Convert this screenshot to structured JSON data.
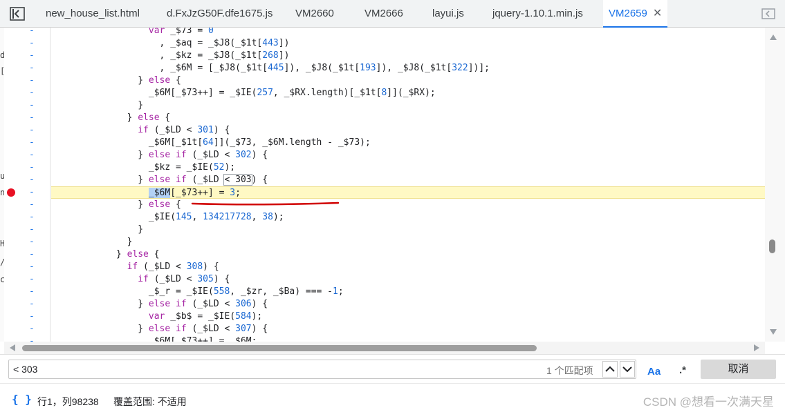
{
  "tabs": [
    {
      "label": "new_house_list.html"
    },
    {
      "label": "d.FxJzG50F.dfe1675.js"
    },
    {
      "label": "VM2660"
    },
    {
      "label": "VM2666"
    },
    {
      "label": "layui.js"
    },
    {
      "label": "jquery-1.10.1.min.js"
    },
    {
      "label": "VM2659",
      "active": true
    }
  ],
  "left_strip_chars": [
    "d",
    "[",
    "u",
    "n",
    "H",
    "/",
    "c"
  ],
  "gutter_marker": "-",
  "code_lines": [
    {
      "indent": "                  ",
      "parts": [
        [
          "kw",
          "var"
        ],
        [
          "p",
          " _$73 = "
        ],
        [
          "num",
          "0"
        ]
      ]
    },
    {
      "indent": "                    ",
      "parts": [
        [
          "p",
          ", _$aq = _$J8(_$1t["
        ],
        [
          "num",
          "443"
        ],
        [
          "p",
          "])"
        ]
      ]
    },
    {
      "indent": "                    ",
      "parts": [
        [
          "p",
          ", _$kz = _$J8(_$1t["
        ],
        [
          "num",
          "268"
        ],
        [
          "p",
          "])"
        ]
      ]
    },
    {
      "indent": "                    ",
      "parts": [
        [
          "p",
          ", _$6M = [_$J8(_$1t["
        ],
        [
          "num",
          "445"
        ],
        [
          "p",
          "]), _$J8(_$1t["
        ],
        [
          "num",
          "193"
        ],
        [
          "p",
          "]), _$J8(_$1t["
        ],
        [
          "num",
          "322"
        ],
        [
          "p",
          "])];"
        ]
      ]
    },
    {
      "indent": "                ",
      "parts": [
        [
          "p",
          "} "
        ],
        [
          "kw",
          "else"
        ],
        [
          "p",
          " {"
        ]
      ]
    },
    {
      "indent": "                  ",
      "parts": [
        [
          "p",
          "_$6M[_$73++] = _$IE("
        ],
        [
          "num",
          "257"
        ],
        [
          "p",
          ", _$RX.length)[_$1t["
        ],
        [
          "num",
          "8"
        ],
        [
          "p",
          "]](_$RX);"
        ]
      ]
    },
    {
      "indent": "                ",
      "parts": [
        [
          "p",
          "}"
        ]
      ]
    },
    {
      "indent": "              ",
      "parts": [
        [
          "p",
          "} "
        ],
        [
          "kw",
          "else"
        ],
        [
          "p",
          " {"
        ]
      ]
    },
    {
      "indent": "                ",
      "parts": [
        [
          "kw",
          "if"
        ],
        [
          "p",
          " (_$LD < "
        ],
        [
          "num",
          "301"
        ],
        [
          "p",
          ") {"
        ]
      ]
    },
    {
      "indent": "                  ",
      "parts": [
        [
          "p",
          "_$6M[_$1t["
        ],
        [
          "num",
          "64"
        ],
        [
          "p",
          "]](_$73, _$6M.length - _$73);"
        ]
      ]
    },
    {
      "indent": "                ",
      "parts": [
        [
          "p",
          "} "
        ],
        [
          "kw",
          "else if"
        ],
        [
          "p",
          " (_$LD < "
        ],
        [
          "num",
          "302"
        ],
        [
          "p",
          ") {"
        ]
      ]
    },
    {
      "indent": "                  ",
      "parts": [
        [
          "p",
          "_$kz = _$IE("
        ],
        [
          "num",
          "52"
        ],
        [
          "p",
          ");"
        ]
      ]
    },
    {
      "indent": "                ",
      "parts": [
        [
          "p",
          "} "
        ],
        [
          "kw",
          "else if"
        ],
        [
          "p",
          " (_$LD "
        ],
        [
          "box",
          "< 303"
        ],
        [
          "p",
          ") {"
        ]
      ]
    },
    {
      "indent": "                  ",
      "parts": [
        [
          "sel",
          "_$6M"
        ],
        [
          "p",
          "[_$73++] = "
        ],
        [
          "num",
          "3"
        ],
        [
          "p",
          ";"
        ]
      ],
      "highlight": true
    },
    {
      "indent": "                ",
      "parts": [
        [
          "p",
          "} "
        ],
        [
          "kw",
          "else"
        ],
        [
          "p",
          " {"
        ]
      ]
    },
    {
      "indent": "                  ",
      "parts": [
        [
          "p",
          "_$IE("
        ],
        [
          "num",
          "145"
        ],
        [
          "p",
          ", "
        ],
        [
          "num",
          "134217728"
        ],
        [
          "p",
          ", "
        ],
        [
          "num",
          "38"
        ],
        [
          "p",
          ");"
        ]
      ]
    },
    {
      "indent": "                ",
      "parts": [
        [
          "p",
          "}"
        ]
      ]
    },
    {
      "indent": "              ",
      "parts": [
        [
          "p",
          "}"
        ]
      ]
    },
    {
      "indent": "            ",
      "parts": [
        [
          "p",
          "} "
        ],
        [
          "kw",
          "else"
        ],
        [
          "p",
          " {"
        ]
      ]
    },
    {
      "indent": "              ",
      "parts": [
        [
          "kw",
          "if"
        ],
        [
          "p",
          " (_$LD < "
        ],
        [
          "num",
          "308"
        ],
        [
          "p",
          ") {"
        ]
      ]
    },
    {
      "indent": "                ",
      "parts": [
        [
          "kw",
          "if"
        ],
        [
          "p",
          " (_$LD < "
        ],
        [
          "num",
          "305"
        ],
        [
          "p",
          ") {"
        ]
      ]
    },
    {
      "indent": "                  ",
      "parts": [
        [
          "p",
          "_$_r = _$IE("
        ],
        [
          "num",
          "558"
        ],
        [
          "p",
          ", _$zr, _$Ba) === -"
        ],
        [
          "num",
          "1"
        ],
        [
          "p",
          ";"
        ]
      ]
    },
    {
      "indent": "                ",
      "parts": [
        [
          "p",
          "} "
        ],
        [
          "kw",
          "else if"
        ],
        [
          "p",
          " (_$LD < "
        ],
        [
          "num",
          "306"
        ],
        [
          "p",
          ") {"
        ]
      ]
    },
    {
      "indent": "                  ",
      "parts": [
        [
          "kw",
          "var"
        ],
        [
          "p",
          " _$b$ = _$IE("
        ],
        [
          "num",
          "584"
        ],
        [
          "p",
          ");"
        ]
      ]
    },
    {
      "indent": "                ",
      "parts": [
        [
          "p",
          "} "
        ],
        [
          "kw",
          "else if"
        ],
        [
          "p",
          " (_$LD < "
        ],
        [
          "num",
          "307"
        ],
        [
          "p",
          ") {"
        ]
      ]
    },
    {
      "indent": "                  ",
      "parts": [
        [
          "p",
          "_$6M[_$73++] = _$6M;"
        ]
      ]
    }
  ],
  "search": {
    "query": "< 303",
    "match_count": "1 个匹配项",
    "case_label": "Aa",
    "regex_label": ".*",
    "cancel_label": "取消"
  },
  "status": {
    "braces": "{ }",
    "position": "行1，列98238",
    "coverage": "覆盖范围: 不适用"
  },
  "watermark": "CSDN @想看一次满天星",
  "colors": {
    "accent": "#1a73e8",
    "breakpoint": "#e81123",
    "highlight_line": "#fff9c4",
    "keyword": "#a626a4",
    "number": "#1c00cf"
  }
}
